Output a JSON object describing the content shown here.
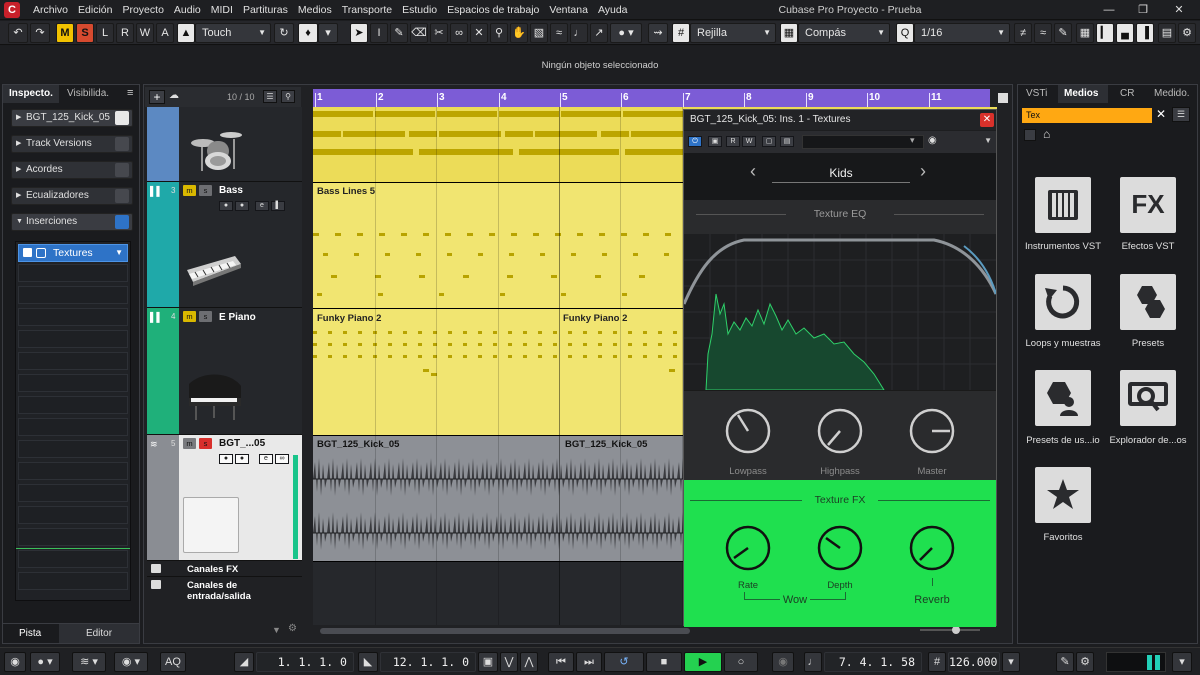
{
  "menu": {
    "items": [
      "Archivo",
      "Edición",
      "Proyecto",
      "Audio",
      "MIDI",
      "Partituras",
      "Medios",
      "Transporte",
      "Estudio",
      "Espacios de trabajo",
      "Ventana",
      "Ayuda"
    ],
    "window_title": "Cubase Pro Proyecto - Prueba"
  },
  "toolbar": {
    "automation_letters": [
      "M",
      "S",
      "L",
      "R",
      "W",
      "A"
    ],
    "automation_mode": "Touch",
    "snap_type": "Rejilla",
    "grid_type": "Compás",
    "quantize": "1/16"
  },
  "status": {
    "message": "Ningún objeto seleccionado"
  },
  "inspector": {
    "tabs": [
      "Inspecto.",
      "Visibilida."
    ],
    "track_name": "BGT_125_Kick_05",
    "sections": [
      "Track Versions",
      "Acordes",
      "Ecualizadores",
      "Inserciones"
    ],
    "insert_slot": "Textures",
    "bottom_tabs": [
      "Pista",
      "Editor"
    ]
  },
  "tracklist": {
    "count": "10 / 10",
    "tracks": [
      {
        "number": "",
        "name": ""
      },
      {
        "number": "3",
        "name": "Bass"
      },
      {
        "number": "4",
        "name": "E Piano"
      },
      {
        "number": "5",
        "name": "BGT_...05"
      }
    ],
    "folders": [
      "Canales FX",
      "Canales de entrada/salida"
    ]
  },
  "ruler": {
    "bars": [
      "1",
      "2",
      "3",
      "4",
      "5",
      "6",
      "7",
      "8",
      "9",
      "10",
      "11"
    ]
  },
  "clips": {
    "bass": "Bass Lines 5",
    "piano_a": "Funky Piano 2",
    "piano_b": "Funky Piano 2",
    "audio_a": "BGT_125_Kick_05",
    "audio_b": "BGT_125_Kick_05"
  },
  "plugin": {
    "title": "BGT_125_Kick_05: Ins. 1 - Textures",
    "preset": "Kids",
    "eq_title": "Texture EQ",
    "knobs": [
      "Lowpass",
      "Highpass",
      "Master"
    ],
    "fx_title": "Texture FX",
    "fx_knobs": [
      "Rate",
      "Depth",
      "Reverb"
    ],
    "fx_group": "Wow"
  },
  "mediabay": {
    "tabs": [
      "VSTi",
      "Medios",
      "CR",
      "Medido."
    ],
    "search": "Tex",
    "tiles": [
      "Instrumentos VST",
      "Efectos VST",
      "Loops y muestras",
      "Presets",
      "Presets de us...io",
      "Explorador de...os",
      "Favoritos"
    ]
  },
  "transport": {
    "left_locator": "1. 1. 1.  0",
    "right_locator": "12. 1. 1.  0",
    "position": "7. 4. 1. 58",
    "tempo": "126.000",
    "aq": "AQ"
  },
  "colors": {
    "ruler": "#7c5cd6",
    "midi_clip": "#f1e571",
    "fx_panel": "#1fe04f",
    "search_highlight": "#ffa812"
  }
}
